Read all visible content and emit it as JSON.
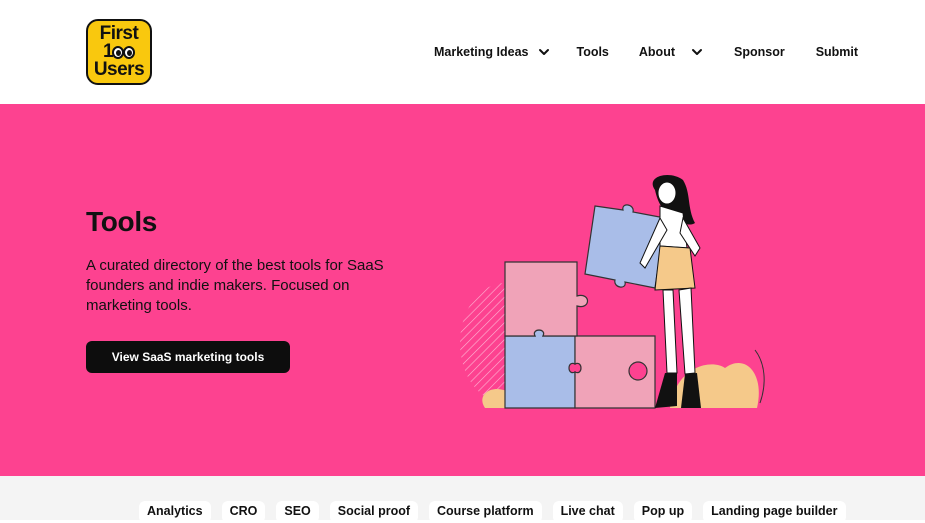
{
  "logo": {
    "line1": "First",
    "line2_digit": "1",
    "line3": "Users"
  },
  "nav": {
    "items": [
      {
        "label": "Marketing Ideas",
        "has_dropdown": true
      },
      {
        "label": "Tools",
        "has_dropdown": false
      },
      {
        "label": "About",
        "has_dropdown": true
      },
      {
        "label": "Sponsor",
        "has_dropdown": false
      },
      {
        "label": "Submit",
        "has_dropdown": false
      }
    ]
  },
  "hero": {
    "title": "Tools",
    "description": "A curated directory of the best tools for SaaS founders and indie makers. Focused on marketing tools.",
    "cta_label": "View SaaS marketing tools",
    "background_color": "#fd4290"
  },
  "tags": [
    "Analytics",
    "CRO",
    "SEO",
    "Social proof",
    "Course platform",
    "Live chat",
    "Pop up",
    "Landing page builder"
  ],
  "colors": {
    "accent_pink": "#fd4290",
    "logo_yellow": "#f9c80e",
    "button_dark": "#0d0d0d"
  }
}
